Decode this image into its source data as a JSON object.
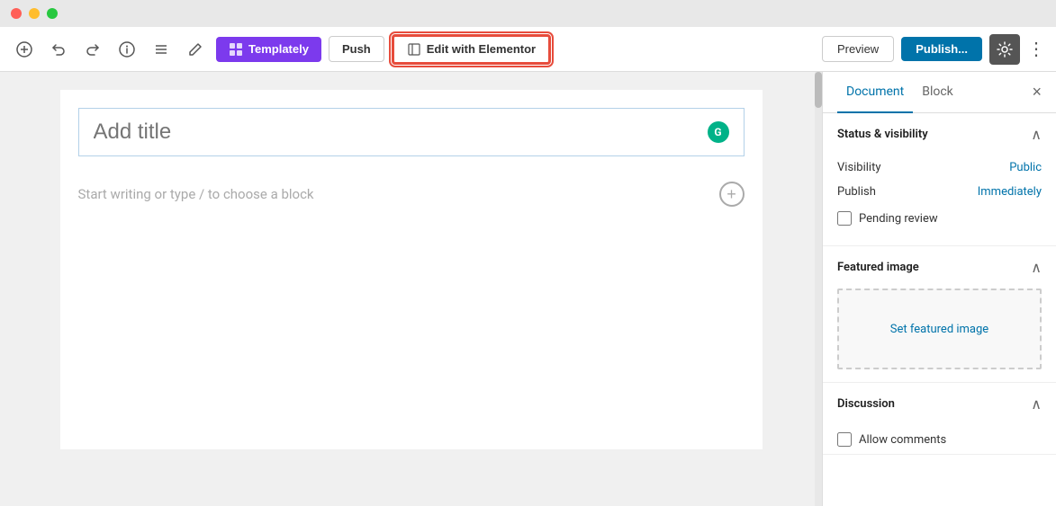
{
  "titleBar": {
    "trafficLights": [
      "red",
      "yellow",
      "green"
    ]
  },
  "toolbar": {
    "undoLabel": "↩",
    "redoLabel": "↪",
    "infoLabel": "ℹ",
    "listLabel": "≡",
    "penLabel": "✎",
    "templatlyLabel": "Templately",
    "pushLabel": "Push",
    "elementorLabel": "Edit with Elementor",
    "previewLabel": "Preview",
    "publishLabel": "Publish...",
    "settingsIcon": "⚙",
    "moreIcon": "⋮"
  },
  "editor": {
    "titlePlaceholder": "Add title",
    "contentPlaceholder": "Start writing or type / to choose a block",
    "grammarlyIcon": "G"
  },
  "sidebar": {
    "tabs": [
      {
        "label": "Document",
        "active": true
      },
      {
        "label": "Block",
        "active": false
      }
    ],
    "closeLabel": "×",
    "sections": [
      {
        "id": "status-visibility",
        "title": "Status & visibility",
        "expanded": true,
        "rows": [
          {
            "label": "Visibility",
            "value": "Public",
            "isLink": true
          },
          {
            "label": "Publish",
            "value": "Immediately",
            "isLink": true
          }
        ],
        "checkboxes": [
          {
            "label": "Pending review",
            "checked": false
          }
        ]
      },
      {
        "id": "featured-image",
        "title": "Featured image",
        "expanded": true,
        "setImageLabel": "Set featured image"
      },
      {
        "id": "discussion",
        "title": "Discussion",
        "expanded": true,
        "checkboxes": [
          {
            "label": "Allow comments",
            "checked": false
          }
        ]
      }
    ]
  }
}
